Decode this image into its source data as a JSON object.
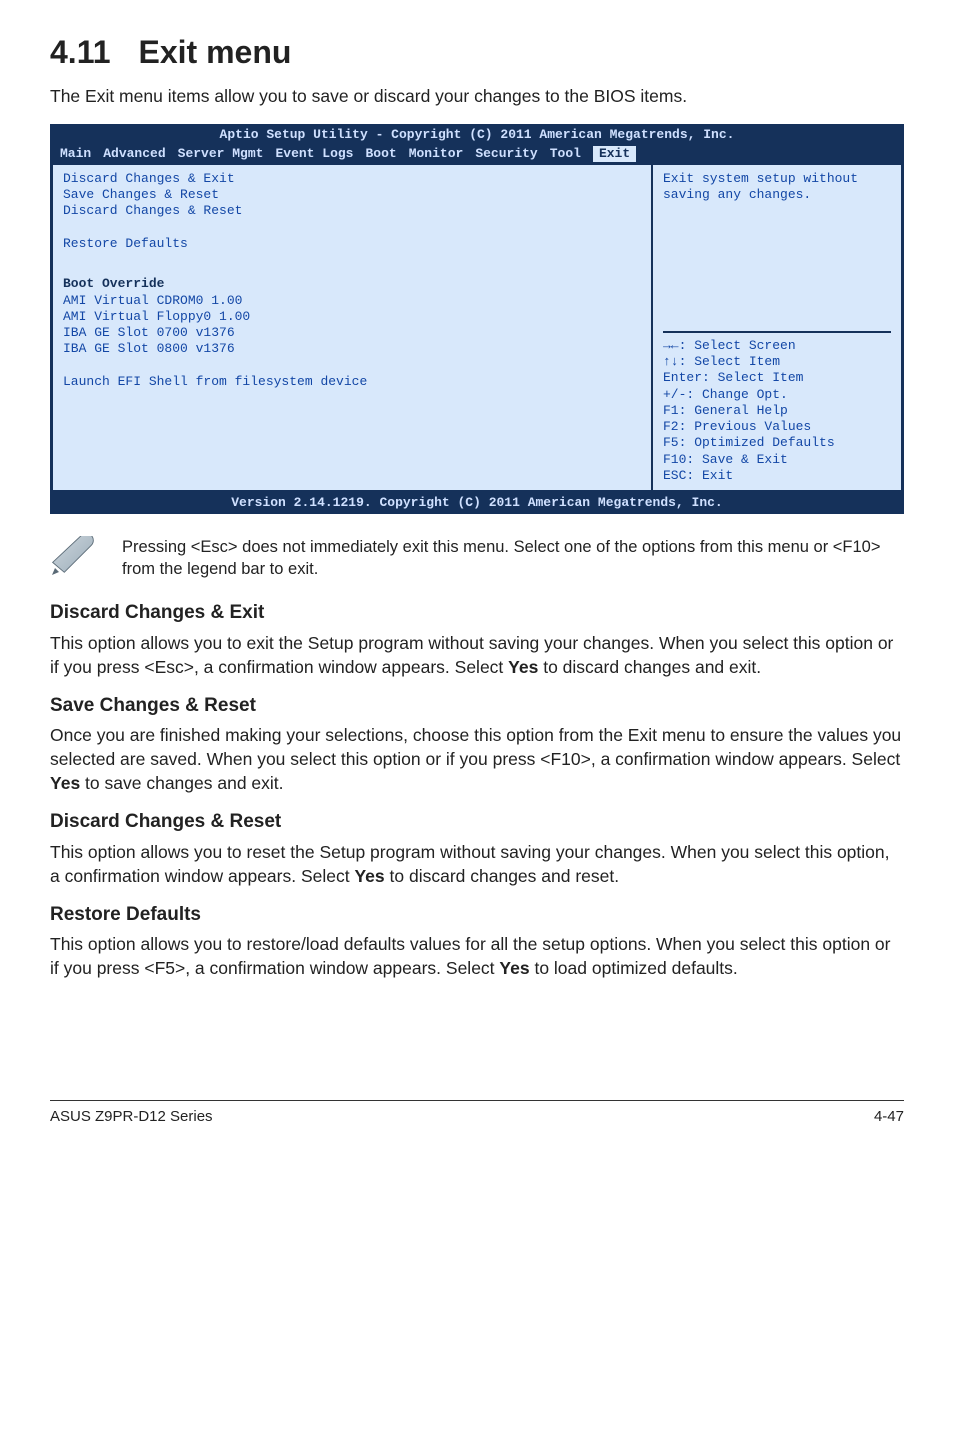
{
  "heading": {
    "number": "4.11",
    "title": "Exit menu"
  },
  "intro": "The Exit menu items allow you to save or discard your changes to the BIOS items.",
  "bios": {
    "title": "Aptio Setup Utility - Copyright (C) 2011 American Megatrends, Inc.",
    "menu": [
      "Main",
      "Advanced",
      "Server Mgmt",
      "Event Logs",
      "Boot",
      "Monitor",
      "Security",
      "Tool",
      "Exit"
    ],
    "active_menu_index": 8,
    "left": {
      "items": [
        {
          "label": "Discard Changes & Exit",
          "type": "item",
          "interactable": true
        },
        {
          "label": "Save Changes & Reset",
          "type": "item",
          "interactable": true
        },
        {
          "label": "Discard Changes & Reset",
          "type": "item",
          "interactable": true
        },
        {
          "label": "",
          "type": "spacer"
        },
        {
          "label": "Restore Defaults",
          "type": "item",
          "interactable": true
        },
        {
          "label": "",
          "type": "spacer"
        },
        {
          "label": "Boot Override",
          "type": "header"
        },
        {
          "label": "AMI Virtual CDROM0 1.00",
          "type": "item",
          "interactable": true
        },
        {
          "label": "AMI Virtual Floppy0 1.00",
          "type": "item",
          "interactable": true
        },
        {
          "label": "IBA GE Slot 0700 v1376",
          "type": "item",
          "interactable": true
        },
        {
          "label": "IBA GE Slot 0800 v1376",
          "type": "item",
          "interactable": true
        },
        {
          "label": "",
          "type": "spacer"
        },
        {
          "label": "Launch EFI Shell from filesystem device",
          "type": "item",
          "interactable": true
        }
      ]
    },
    "help_text": "Exit system setup without saving any changes.",
    "keys": [
      "→←: Select Screen",
      "↑↓:  Select Item",
      "Enter: Select Item",
      "+/-: Change Opt.",
      "F1: General Help",
      "F2: Previous Values",
      "F5: Optimized Defaults",
      "F10: Save & Exit",
      "ESC: Exit"
    ],
    "footer": "Version 2.14.1219. Copyright (C) 2011 American Megatrends, Inc."
  },
  "note": "Pressing <Esc> does not immediately exit this menu. Select one of the options from this menu or <F10> from the legend bar to exit.",
  "sections": [
    {
      "title": "Discard Changes & Exit",
      "body": "This option allows you to exit the Setup program without saving your changes. When you select this option or if you press <Esc>, a confirmation window appears. Select Yes to discard changes and exit.",
      "bold_words": [
        "Yes"
      ]
    },
    {
      "title": "Save Changes & Reset",
      "body": "Once you are finished making your selections, choose this option from the Exit menu to ensure the values you selected are saved. When you select this option or if you press <F10>, a confirmation window appears. Select Yes to save changes and exit.",
      "bold_words": [
        "Yes"
      ]
    },
    {
      "title": "Discard Changes & Reset",
      "body": "This option allows you to reset the Setup program without saving your changes. When you select this option, a confirmation window appears. Select Yes to discard changes and reset.",
      "bold_words": [
        "Yes"
      ]
    },
    {
      "title": "Restore Defaults",
      "body": "This option allows you to restore/load defaults values for all the setup options. When you select this option or if you press <F5>, a confirmation window appears. Select Yes to load optimized defaults.",
      "bold_words": [
        "Yes"
      ]
    }
  ],
  "page_footer": {
    "left": "ASUS Z9PR-D12 Series",
    "right": "4-47"
  }
}
